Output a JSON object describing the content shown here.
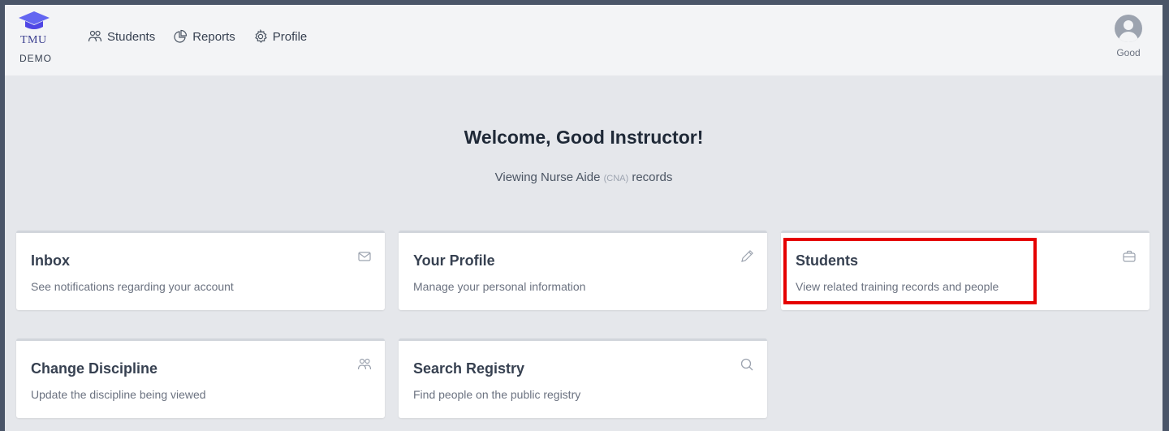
{
  "app": {
    "logo_top": "TMU",
    "logo_bottom": "DEMO"
  },
  "nav": {
    "items": [
      {
        "label": "Students",
        "icon": "users-icon"
      },
      {
        "label": "Reports",
        "icon": "pie-chart-icon"
      },
      {
        "label": "Profile",
        "icon": "gear-icon"
      }
    ]
  },
  "user": {
    "name": "Good"
  },
  "welcome": {
    "title": "Welcome, Good Instructor!",
    "sub_prefix": "Viewing Nurse Aide",
    "sub_abbr": "(CNA)",
    "sub_suffix": "records"
  },
  "cards": [
    {
      "title": "Inbox",
      "desc": "See notifications regarding your account",
      "icon": "mail-icon"
    },
    {
      "title": "Your Profile",
      "desc": "Manage your personal information",
      "icon": "pencil-icon"
    },
    {
      "title": "Students",
      "desc": "View related training records and people",
      "icon": "briefcase-icon"
    },
    {
      "title": "Change Discipline",
      "desc": "Update the discipline being viewed",
      "icon": "users-icon"
    },
    {
      "title": "Search Registry",
      "desc": "Find people on the public registry",
      "icon": "search-icon"
    }
  ],
  "colors": {
    "highlight": "#e50000",
    "brand": "#6366f1"
  }
}
